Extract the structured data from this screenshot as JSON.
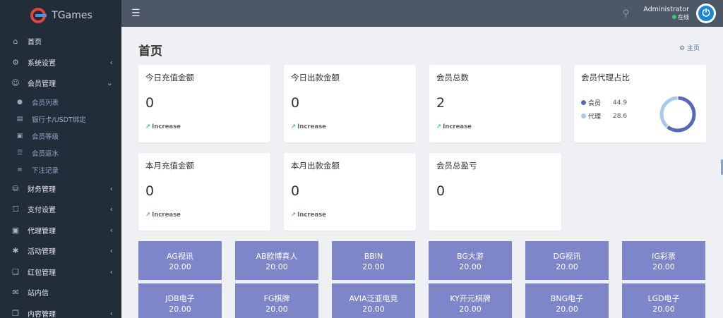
{
  "brand": {
    "name": "TGames"
  },
  "sidebar": {
    "items": [
      {
        "label": "首页",
        "icon": "home-icon",
        "chevron": ""
      },
      {
        "label": "系统设置",
        "icon": "gears-icon",
        "chevron": "‹"
      },
      {
        "label": "会员管理",
        "icon": "user-icon",
        "chevron": "⌄"
      },
      {
        "label": "会员列表",
        "icon": "person-icon",
        "chevron": ""
      },
      {
        "label": "银行卡/USDT绑定",
        "icon": "credit-card-icon",
        "chevron": ""
      },
      {
        "label": "会员等级",
        "icon": "id-badge-icon",
        "chevron": ""
      },
      {
        "label": "会员返水",
        "icon": "list-icon",
        "chevron": ""
      },
      {
        "label": "下注记录",
        "icon": "bars-icon",
        "chevron": ""
      },
      {
        "label": "财务管理",
        "icon": "database-icon",
        "chevron": "‹"
      },
      {
        "label": "支付设置",
        "icon": "bookmark-icon",
        "chevron": "‹"
      },
      {
        "label": "代理管理",
        "icon": "agent-card-icon",
        "chevron": "‹"
      },
      {
        "label": "活动管理",
        "icon": "network-icon",
        "chevron": "‹"
      },
      {
        "label": "红包管理",
        "icon": "clone-icon",
        "chevron": "‹"
      },
      {
        "label": "站内信",
        "icon": "envelope-icon",
        "chevron": ""
      },
      {
        "label": "内容管理",
        "icon": "copy-icon",
        "chevron": "‹"
      }
    ]
  },
  "topbar": {
    "menu_icon": "☰",
    "user_name": "Administrator",
    "user_status": "在线"
  },
  "page": {
    "title": "首页",
    "breadcrumb": "主页"
  },
  "stats": [
    {
      "title": "今日充值金额",
      "value": "0",
      "trend": "Increase"
    },
    {
      "title": "今日出款金额",
      "value": "0",
      "trend": "Increase"
    },
    {
      "title": "会员总数",
      "value": "2",
      "trend": "Increase"
    },
    {
      "title": "本月充值金额",
      "value": "0",
      "trend": "Increase"
    },
    {
      "title": "本月出款金额",
      "value": "0",
      "trend": "Increase"
    },
    {
      "title": "会员总盈亏",
      "value": "0"
    }
  ],
  "ratio_card": {
    "title": "会员代理占比",
    "legend": [
      {
        "name": "会员",
        "value": "44.9",
        "color": "#5867b8"
      },
      {
        "name": "代理",
        "value": "28.6",
        "color": "#a9c8ea"
      }
    ]
  },
  "chart_data": {
    "type": "pie",
    "categories": [
      "会员",
      "代理"
    ],
    "values": [
      44.9,
      28.6
    ]
  },
  "games": [
    {
      "name": "AG视讯",
      "amount": "20.00"
    },
    {
      "name": "AB欧博真人",
      "amount": "20.00"
    },
    {
      "name": "BBIN",
      "amount": "20.00"
    },
    {
      "name": "BG大游",
      "amount": "20.00"
    },
    {
      "name": "DG视讯",
      "amount": "20.00"
    },
    {
      "name": "IG彩票",
      "amount": "20.00"
    },
    {
      "name": "JDB电子",
      "amount": "20.00"
    },
    {
      "name": "FG棋牌",
      "amount": "20.00"
    },
    {
      "name": "AVIA泛亚电竞",
      "amount": "20.00"
    },
    {
      "name": "KY开元棋牌",
      "amount": "20.00"
    },
    {
      "name": "BNG电子",
      "amount": "20.00"
    },
    {
      "name": "LGD电子",
      "amount": "20.00"
    }
  ],
  "colors": {
    "sidebar_bg": "#222d3a",
    "topbar_bg": "#4d5866",
    "game_tile": "#7d86c9",
    "online": "#3ac47d",
    "power": "#1a86d8"
  }
}
